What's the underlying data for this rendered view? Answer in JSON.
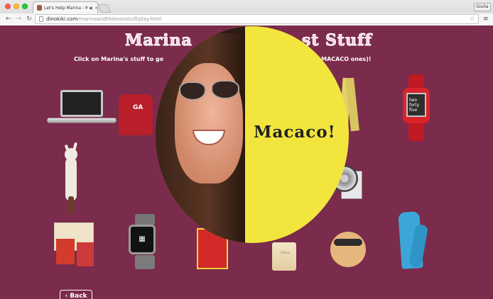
{
  "browser": {
    "tab_title": "Let's Help Marina - Ma",
    "audio_icon": "speaker-icon",
    "close_glyph": "×",
    "profile_name": "Giulia",
    "url_domain": "dinokiki.com",
    "url_path": "/marinaandthelostsstuff/play.html"
  },
  "page": {
    "title": "Marina's Lost Stuff",
    "title_left": "Marina",
    "title_right": "st Stuff",
    "subtitle_left": "Click on Marina's stuff to ge",
    "subtitle_right": "a's things (the MACACO ones)!",
    "back_label": "‹ Back",
    "overlay_label": "Macaco!",
    "sweatshirt_text": "GA",
    "pebble_text": "two forty five",
    "iphone_text": "iPhone",
    "accent_color": "#7b2b4b",
    "overlay_color": "#f2e53e"
  }
}
